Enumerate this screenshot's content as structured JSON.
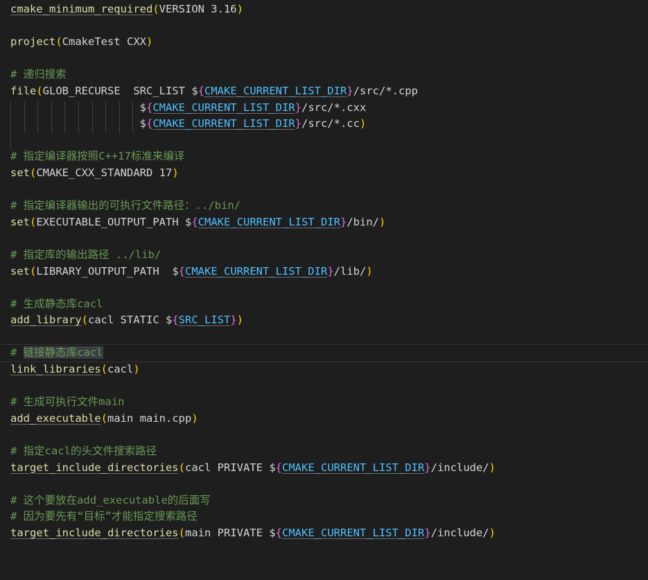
{
  "editor": {
    "lines": [
      {
        "id": "l1",
        "parts": [
          {
            "t": "cmake_minimum_required",
            "c": "fn",
            "u": true
          },
          {
            "t": "(",
            "c": "paren"
          },
          {
            "t": "VERSION 3.16",
            "c": "plain"
          },
          {
            "t": ")",
            "c": "paren"
          }
        ]
      },
      {
        "id": "l2",
        "parts": []
      },
      {
        "id": "l3",
        "parts": [
          {
            "t": "project",
            "c": "fn"
          },
          {
            "t": "(",
            "c": "paren"
          },
          {
            "t": "CmakeTest CXX",
            "c": "plain"
          },
          {
            "t": ")",
            "c": "paren"
          }
        ]
      },
      {
        "id": "l4",
        "parts": []
      },
      {
        "id": "l5",
        "parts": [
          {
            "t": "# 递归搜索",
            "c": "comment"
          }
        ]
      },
      {
        "id": "l6",
        "parts": [
          {
            "t": "file",
            "c": "fn"
          },
          {
            "t": "(",
            "c": "paren"
          },
          {
            "t": "GLOB_RECURSE  SRC_LIST ",
            "c": "plain"
          },
          {
            "t": "$",
            "c": "dollar"
          },
          {
            "t": "{",
            "c": "brace"
          },
          {
            "t": "CMAKE_CURRENT_LIST_DIR",
            "c": "var",
            "u": true
          },
          {
            "t": "}",
            "c": "brace"
          },
          {
            "t": "/src/*.cpp",
            "c": "plain"
          }
        ]
      },
      {
        "id": "l7",
        "parts": [
          {
            "t": "                    ",
            "c": "plain"
          },
          {
            "t": "$",
            "c": "dollar"
          },
          {
            "t": "{",
            "c": "brace"
          },
          {
            "t": "CMAKE_CURRENT_LIST_DIR",
            "c": "var",
            "u": true
          },
          {
            "t": "}",
            "c": "brace"
          },
          {
            "t": "/src/*.cxx",
            "c": "plain"
          }
        ]
      },
      {
        "id": "l8",
        "parts": [
          {
            "t": "                    ",
            "c": "plain"
          },
          {
            "t": "$",
            "c": "dollar"
          },
          {
            "t": "{",
            "c": "brace"
          },
          {
            "t": "CMAKE_CURRENT_LIST_DIR",
            "c": "var",
            "u": true
          },
          {
            "t": "}",
            "c": "brace"
          },
          {
            "t": "/src/*.cc",
            "c": "plain"
          },
          {
            "t": ")",
            "c": "paren"
          }
        ]
      },
      {
        "id": "l9",
        "parts": []
      },
      {
        "id": "l10",
        "parts": [
          {
            "t": "# 指定编译器按照C++17标准来编译",
            "c": "comment"
          }
        ]
      },
      {
        "id": "l11",
        "parts": [
          {
            "t": "set",
            "c": "fn"
          },
          {
            "t": "(",
            "c": "paren"
          },
          {
            "t": "CMAKE_CXX_STANDARD 17",
            "c": "plain"
          },
          {
            "t": ")",
            "c": "paren"
          }
        ]
      },
      {
        "id": "l12",
        "parts": []
      },
      {
        "id": "l13",
        "parts": [
          {
            "t": "# 指定编译器输出的可执行文件路径：../bin/",
            "c": "comment"
          }
        ]
      },
      {
        "id": "l14",
        "parts": [
          {
            "t": "set",
            "c": "fn"
          },
          {
            "t": "(",
            "c": "paren"
          },
          {
            "t": "EXECUTABLE_OUTPUT_PATH ",
            "c": "plain"
          },
          {
            "t": "$",
            "c": "dollar"
          },
          {
            "t": "{",
            "c": "brace"
          },
          {
            "t": "CMAKE_CURRENT_LIST_DIR",
            "c": "var",
            "u": true
          },
          {
            "t": "}",
            "c": "brace"
          },
          {
            "t": "/bin/",
            "c": "plain"
          },
          {
            "t": ")",
            "c": "paren"
          }
        ]
      },
      {
        "id": "l15",
        "parts": []
      },
      {
        "id": "l16",
        "parts": [
          {
            "t": "# 指定库的输出路径 ../lib/",
            "c": "comment"
          }
        ]
      },
      {
        "id": "l17",
        "parts": [
          {
            "t": "set",
            "c": "fn"
          },
          {
            "t": "(",
            "c": "paren"
          },
          {
            "t": "LIBRARY_OUTPUT_PATH  ",
            "c": "plain"
          },
          {
            "t": "$",
            "c": "dollar"
          },
          {
            "t": "{",
            "c": "brace"
          },
          {
            "t": "CMAKE_CURRENT_LIST_DIR",
            "c": "var",
            "u": true
          },
          {
            "t": "}",
            "c": "brace"
          },
          {
            "t": "/lib/",
            "c": "plain"
          },
          {
            "t": ")",
            "c": "paren"
          }
        ]
      },
      {
        "id": "l18",
        "parts": []
      },
      {
        "id": "l19",
        "parts": [
          {
            "t": "# 生成静态库cacl",
            "c": "comment"
          }
        ]
      },
      {
        "id": "l20",
        "parts": [
          {
            "t": "add_library",
            "c": "fn",
            "u": true
          },
          {
            "t": "(",
            "c": "paren"
          },
          {
            "t": "cacl STATIC ",
            "c": "plain"
          },
          {
            "t": "$",
            "c": "dollar"
          },
          {
            "t": "{",
            "c": "brace"
          },
          {
            "t": "SRC_LIST",
            "c": "var",
            "u": true
          },
          {
            "t": "}",
            "c": "brace"
          },
          {
            "t": ")",
            "c": "paren"
          }
        ]
      },
      {
        "id": "l21",
        "parts": []
      },
      {
        "id": "l22",
        "current": true,
        "parts": [
          {
            "t": "# ",
            "c": "comment"
          },
          {
            "t": "链接静态库cacl",
            "c": "comment",
            "s": true
          }
        ]
      },
      {
        "id": "l23",
        "parts": [
          {
            "t": "link_libraries",
            "c": "fn",
            "u": true
          },
          {
            "t": "(",
            "c": "paren"
          },
          {
            "t": "cacl",
            "c": "plain"
          },
          {
            "t": ")",
            "c": "paren"
          }
        ]
      },
      {
        "id": "l24",
        "parts": []
      },
      {
        "id": "l25",
        "parts": [
          {
            "t": "# 生成可执行文件main",
            "c": "comment"
          }
        ]
      },
      {
        "id": "l26",
        "parts": [
          {
            "t": "add_executable",
            "c": "fn",
            "u": true
          },
          {
            "t": "(",
            "c": "paren"
          },
          {
            "t": "main main.cpp",
            "c": "plain"
          },
          {
            "t": ")",
            "c": "paren"
          }
        ]
      },
      {
        "id": "l27",
        "parts": []
      },
      {
        "id": "l28",
        "parts": [
          {
            "t": "# 指定cacl的头文件搜索路径",
            "c": "comment"
          }
        ]
      },
      {
        "id": "l29",
        "parts": [
          {
            "t": "target_include_directories",
            "c": "fn",
            "u": true
          },
          {
            "t": "(",
            "c": "paren"
          },
          {
            "t": "cacl PRIVATE ",
            "c": "plain"
          },
          {
            "t": "$",
            "c": "dollar"
          },
          {
            "t": "{",
            "c": "brace"
          },
          {
            "t": "CMAKE_CURRENT_LIST_DIR",
            "c": "var",
            "u": true
          },
          {
            "t": "}",
            "c": "brace"
          },
          {
            "t": "/include/",
            "c": "plain"
          },
          {
            "t": ")",
            "c": "paren"
          }
        ]
      },
      {
        "id": "l30",
        "parts": []
      },
      {
        "id": "l31",
        "parts": [
          {
            "t": "# 这个要放在add_executable的后面写",
            "c": "comment"
          }
        ]
      },
      {
        "id": "l32",
        "parts": [
          {
            "t": "# 因为要先有“目标”才能指定搜索路径",
            "c": "comment"
          }
        ]
      },
      {
        "id": "l33",
        "parts": [
          {
            "t": "target_include_directories",
            "c": "fn",
            "u": true
          },
          {
            "t": "(",
            "c": "paren"
          },
          {
            "t": "main PRIVATE ",
            "c": "plain"
          },
          {
            "t": "$",
            "c": "dollar"
          },
          {
            "t": "{",
            "c": "brace"
          },
          {
            "t": "CMAKE_CURRENT_LIST_DIR",
            "c": "var",
            "u": true
          },
          {
            "t": "}",
            "c": "brace"
          },
          {
            "t": "/include/",
            "c": "plain"
          },
          {
            "t": ")",
            "c": "paren"
          }
        ]
      }
    ]
  }
}
